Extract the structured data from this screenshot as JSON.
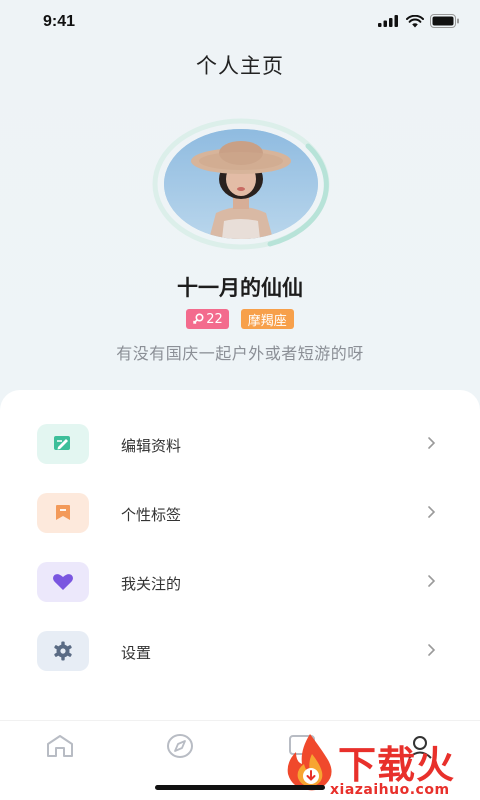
{
  "status_bar": {
    "time": "9:41"
  },
  "header": {
    "title": "个人主页"
  },
  "profile": {
    "name": "十一月的仙仙",
    "age": "22",
    "zodiac": "摩羯座",
    "bio": "有没有国庆一起户外或者短游的呀"
  },
  "menu": {
    "items": [
      {
        "label": "编辑资料",
        "icon": "edit-icon",
        "bg": "#e3f6f1",
        "color": "#3dbf9a"
      },
      {
        "label": "个性标签",
        "icon": "bookmark-icon",
        "bg": "#fde9dc",
        "color": "#f39a5a"
      },
      {
        "label": "我关注的",
        "icon": "heart-icon",
        "bg": "#ece8fb",
        "color": "#7a56e0"
      },
      {
        "label": "设置",
        "icon": "gear-icon",
        "bg": "#e7edf5",
        "color": "#5a6b84"
      }
    ]
  },
  "tabbar": {
    "tabs": [
      "home-icon",
      "compass-icon",
      "message-icon",
      "profile-icon"
    ]
  },
  "watermark": {
    "text": "下载火",
    "url": "xiazaihuo.com"
  }
}
